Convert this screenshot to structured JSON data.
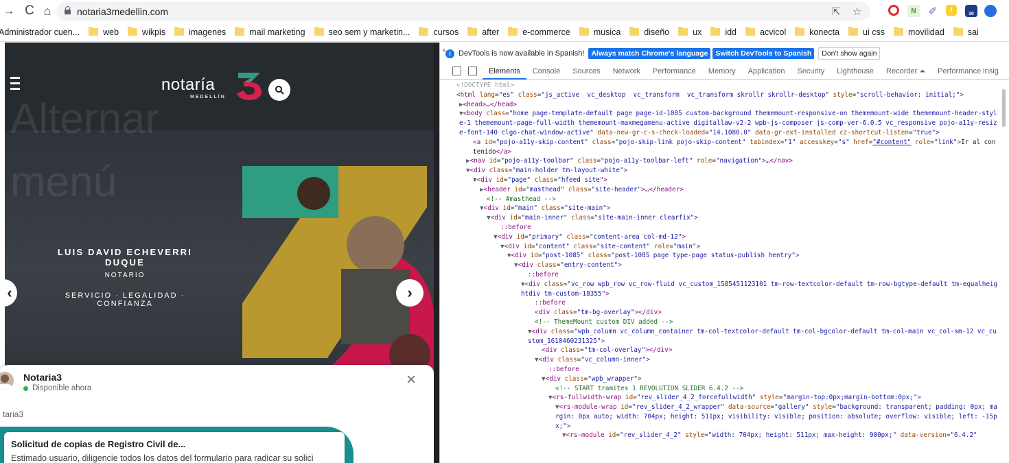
{
  "browser": {
    "url": "notaria3medellin.com",
    "extension_badge": "30"
  },
  "bookmarks": [
    "Administrador cuen...",
    "web",
    "wikpis",
    "imagenes",
    "mail marketing",
    "seo sem y marketin...",
    "cursos",
    "after",
    "e-commerce",
    "musica",
    "diseño",
    "ux",
    "idd",
    "acvicol",
    "konecta",
    "ui css",
    "movilidad",
    "sai"
  ],
  "site": {
    "bg_text": "Alternar menú",
    "logo_word": "notaría",
    "logo_sub": "MEDELLÍN",
    "logo_number": "3",
    "notary_name": "LUIS DAVID ECHEVERRI DUQUE",
    "notary_role": "NOTARIO",
    "tagline": "SERVICIO · LEGALIDAD · CONFIANZA",
    "colors": {
      "teal": "#2e9d80",
      "gold": "#c9a227",
      "crimson": "#d6204e",
      "dark": "#262b30"
    }
  },
  "chat": {
    "name": "Notaria3",
    "status": "Disponible ahora",
    "subheader": "taria3",
    "card_title": "Solicitud de copias de Registro Civil de...",
    "card_body": "Estimado usuario, diligencie todos los datos del formulario para radicar su solici"
  },
  "devtools": {
    "infobar": {
      "message": "DevTools is now available in Spanish!",
      "btn_match": "Always match Chrome's language",
      "btn_switch": "Switch DevTools to Spanish",
      "btn_dismiss": "Don't show again"
    },
    "tabs": [
      "Elements",
      "Console",
      "Sources",
      "Network",
      "Performance",
      "Memory",
      "Application",
      "Security",
      "Lighthouse",
      "Recorder ⏶",
      "Performance insig"
    ]
  }
}
